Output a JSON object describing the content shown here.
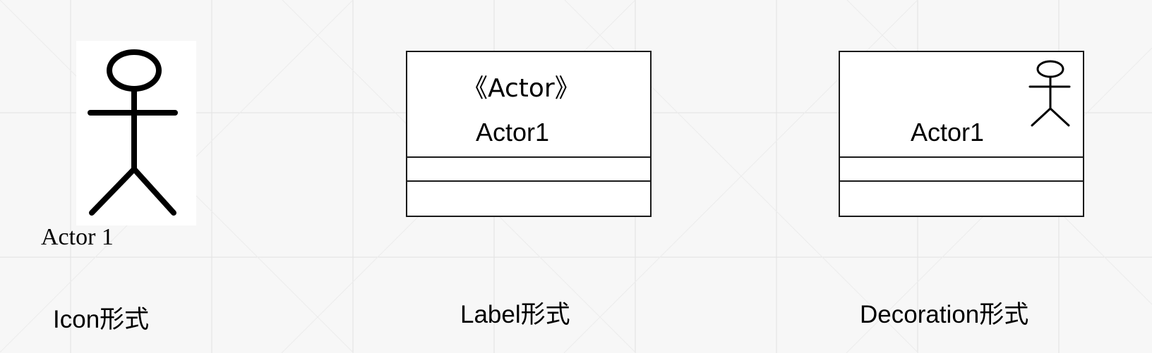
{
  "colors": {
    "background": "#f7f7f7",
    "grid_line": "#e4e4e4",
    "stroke": "#000000"
  },
  "icon_form": {
    "actor_icon": "stick-figure-icon",
    "actor_name": "Actor 1",
    "caption": "Icon形式"
  },
  "label_form": {
    "stereotype": "《Actor》",
    "actor_name": "Actor1",
    "caption": "Label形式"
  },
  "decoration_form": {
    "actor_icon": "stick-figure-icon",
    "actor_name": "Actor1",
    "caption": "Decoration形式"
  }
}
